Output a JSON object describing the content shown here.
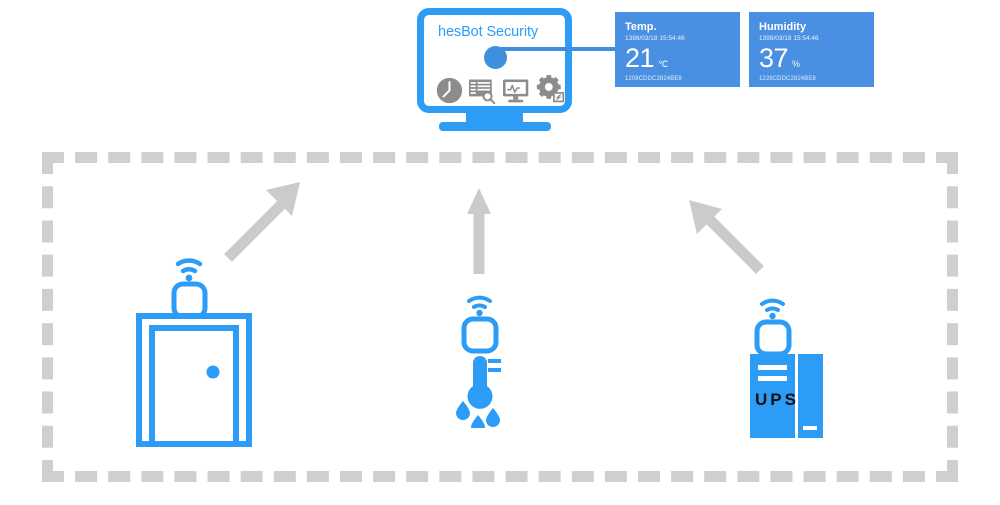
{
  "monitor": {
    "title": "hesBot Security",
    "icons": [
      {
        "name": "clock-icon",
        "label": "Clock"
      },
      {
        "name": "report-search-icon",
        "label": "Reports"
      },
      {
        "name": "monitor-chart-icon",
        "label": "Monitoring"
      },
      {
        "name": "settings-gear-icon",
        "label": "Settings"
      }
    ]
  },
  "cards": [
    {
      "title": "Temp.",
      "timestamp": "1398/03/18 15:54:46",
      "value": "21",
      "unit": "℃",
      "device_id": "1208CDDC2824BE8"
    },
    {
      "title": "Humidity",
      "timestamp": "1398/03/18 15:54:46",
      "value": "37",
      "unit": "%",
      "device_id": "1228CDDC2824BE8"
    }
  ],
  "devices": [
    {
      "name": "door-sensor",
      "label": ""
    },
    {
      "name": "temperature-humidity-sensor",
      "label": ""
    },
    {
      "name": "ups-sensor",
      "label": "UPS"
    }
  ],
  "colors": {
    "accent_blue": "#2d9cf7",
    "card_blue": "#4a90e2",
    "dot_blue": "#3f8fdd",
    "gray": "#cfcfcf",
    "icon_gray": "#8c8c8c"
  }
}
